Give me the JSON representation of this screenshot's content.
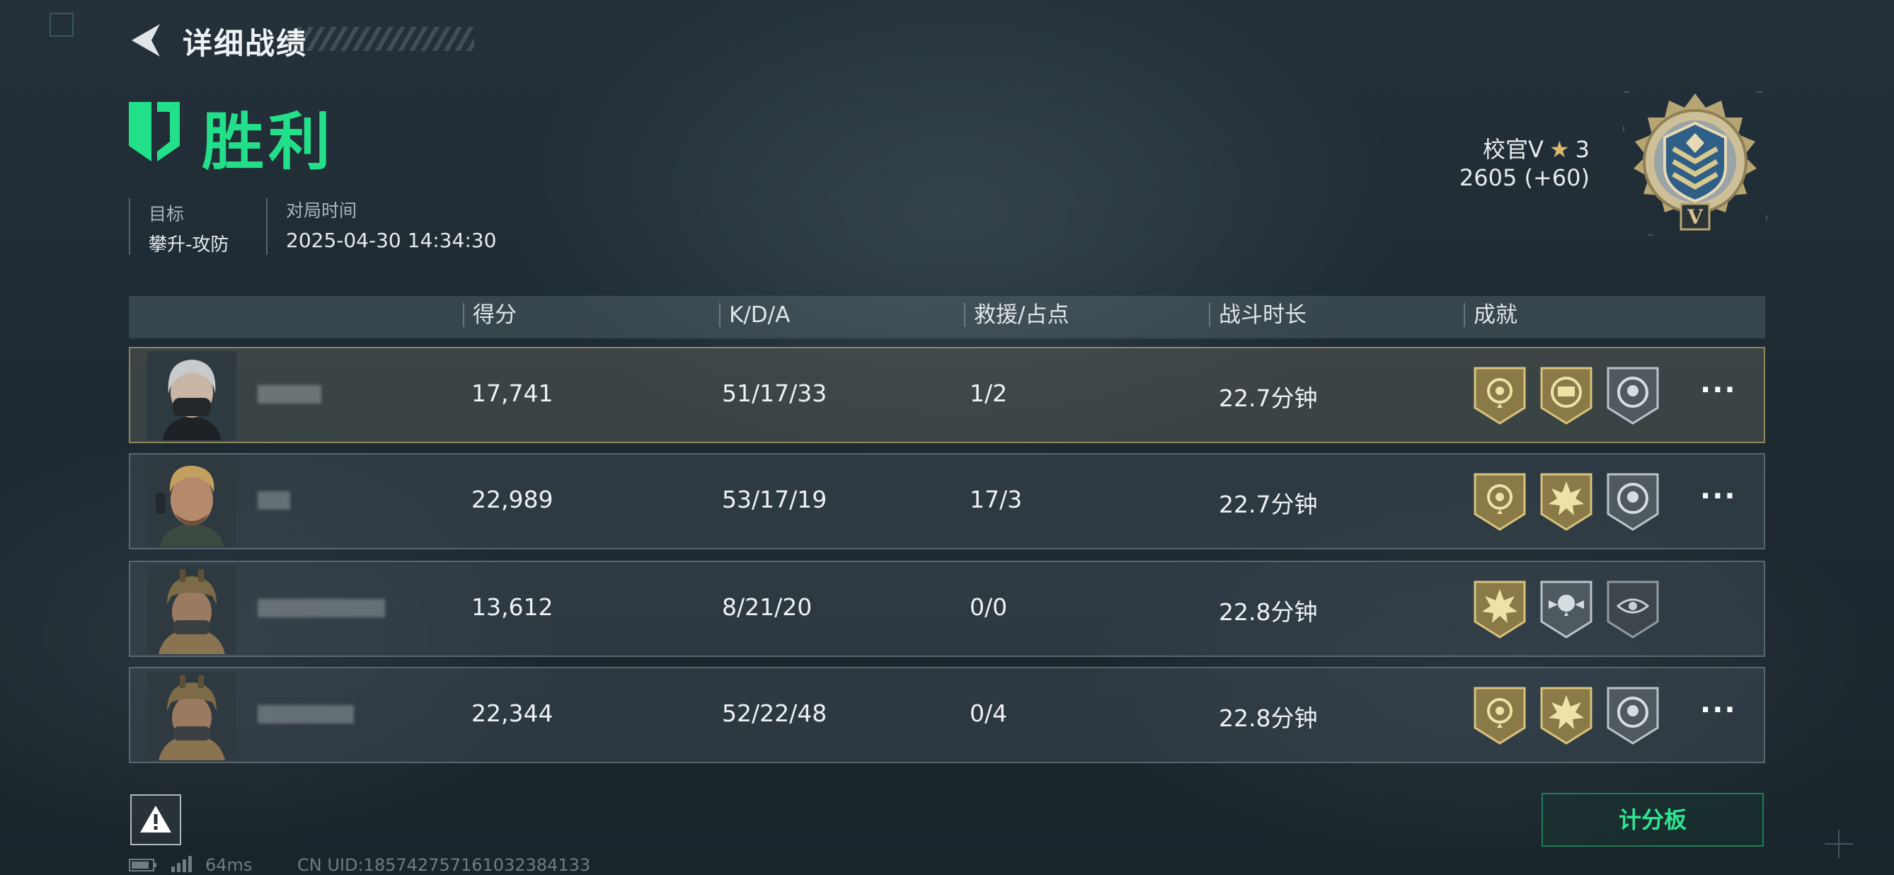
{
  "header": {
    "title": "详细战绩"
  },
  "result": {
    "text": "胜利",
    "color": "#22e08a"
  },
  "meta": {
    "target_label": "目标",
    "target_value": "攀升-攻防",
    "time_label": "对局时间",
    "time_value": "2025-04-30 14:34:30"
  },
  "rank": {
    "name": "校官V",
    "level": "3",
    "score": "2605 (+60)",
    "emblem_letter": "V"
  },
  "table": {
    "columns": [
      "得分",
      "K/D/A",
      "救援/占点",
      "战斗时长",
      "成就"
    ],
    "rows": [
      {
        "score": "17,741",
        "kda": "51/17/33",
        "rescue": "1/2",
        "duration": "22.7分钟",
        "self": true,
        "medals": [
          "rose-medal-icon",
          "mech-medal-icon",
          "skull-target-medal-icon"
        ],
        "more": "···"
      },
      {
        "score": "22,989",
        "kda": "53/17/19",
        "rescue": "17/3",
        "duration": "22.7分钟",
        "self": false,
        "medals": [
          "rose-medal-icon",
          "explosion-medal-icon",
          "skull-target-medal-icon"
        ],
        "more": "···"
      },
      {
        "score": "13,612",
        "kda": "8/21/20",
        "rescue": "0/0",
        "duration": "22.8分钟",
        "self": false,
        "medals": [
          "explosion-medal-icon",
          "skull-wings-medal-icon",
          "eye-target-medal-icon"
        ],
        "more": ""
      },
      {
        "score": "22,344",
        "kda": "52/22/48",
        "rescue": "0/4",
        "duration": "22.8分钟",
        "self": false,
        "medals": [
          "rose-medal-icon",
          "explosion-medal-icon",
          "skull-target-medal-icon"
        ],
        "more": "···"
      }
    ]
  },
  "footer": {
    "scoreboard_label": "计分板",
    "ping": "64ms",
    "uid": "CN UID:185742757161032384133"
  },
  "colors": {
    "accent": "#22e08a",
    "gold": "#c9b06a",
    "panel": "#46545e"
  }
}
